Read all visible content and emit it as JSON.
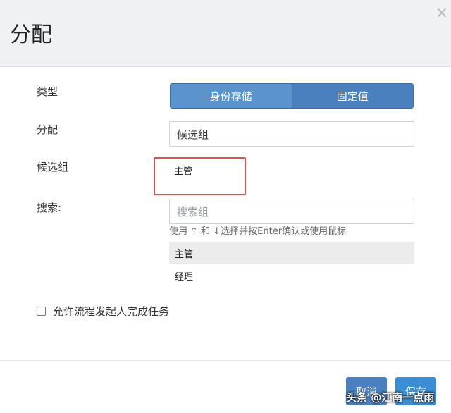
{
  "dialog": {
    "title": "分配",
    "close_glyph": "×"
  },
  "form": {
    "type_label": "类型",
    "type_options": [
      "身份存储",
      "固定值"
    ],
    "type_selected": "身份存储",
    "assign_label": "分配",
    "assign_value": "候选组",
    "candidate_label": "候选组",
    "candidate_selected": "主管",
    "search_label": "搜索:",
    "search_placeholder": "搜索组",
    "search_hint": "使用 ↑ 和 ↓选择并按Enter确认或使用鼠标",
    "results": [
      "主管",
      "经理"
    ],
    "allow_initiator_label": "允许流程发起人完成任务",
    "allow_initiator_checked": false
  },
  "footer": {
    "cancel_label": "取消",
    "save_label": "保存"
  },
  "watermark": "头条 @江南一点雨",
  "colors": {
    "primary": "#4a80bd",
    "primary_active": "#5b93cd",
    "save": "#3b8ed6",
    "highlight_border": "#d9534f",
    "header_bg": "#f0f1f4"
  }
}
